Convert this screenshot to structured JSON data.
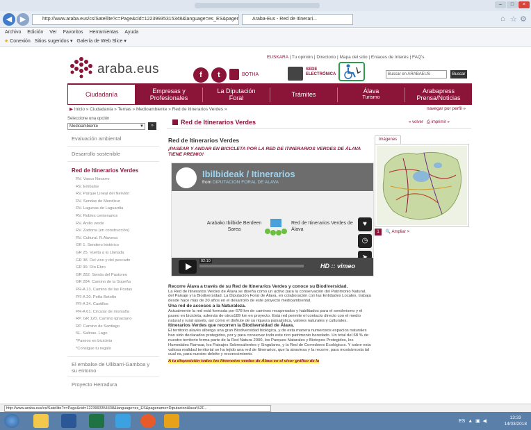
{
  "browser": {
    "address": "http://www.araba.eus/cs/Satellite?c=Page&cid=12239935315348&language=es_ES&pagename=...",
    "tab_title": "Araba-Eus - Red de Itinerari...",
    "menu": [
      "Archivo",
      "Edición",
      "Ver",
      "Favoritos",
      "Herramientas",
      "Ayuda"
    ],
    "favorites": [
      "Conexión",
      "Sitios sugeridos ▾",
      "Galería de Web Slice ▾"
    ],
    "status_url": "http://www.araba.eus/cs/Satellite?c=Page&cid=1223993354438&language=es_ES&pagename=DiputacionAlava%2F..."
  },
  "header": {
    "top_links": [
      "EUSKARA",
      "Tu opinión",
      "Directorio",
      "Mapa del sitio",
      "Enlaces de Interés",
      "FAQ's"
    ],
    "logo_text": "araba.eus",
    "botha_label": "BOTHA",
    "sede_label_1": "SEDE",
    "sede_label_2": "ELECTRÓNICA",
    "search_placeholder": "Buscar en ARABAEUS",
    "search_button": "Buscar"
  },
  "nav": [
    {
      "line1": "Ciudadanía",
      "line2": ""
    },
    {
      "line1": "Empresas y",
      "line2": "Profesionales"
    },
    {
      "line1": "La Diputación",
      "line2": "Foral"
    },
    {
      "line1": "Trámites",
      "line2": ""
    },
    {
      "line1": "Álava",
      "line2": "Turismo"
    },
    {
      "line1": "Arabapress",
      "line2": "Prensa/Noticias"
    }
  ],
  "breadcrumb": [
    "Inicio",
    "Ciudadanía",
    "Temas",
    "Medioambiente",
    "Red de Itinerarios Verdes"
  ],
  "profile_link": "navegar por perfil",
  "selector": {
    "label": "Seleccione una opción",
    "value": "Medioambiente",
    "go": "»"
  },
  "section": {
    "title": "Red de Itinerarios Verdes",
    "back": "« volver",
    "print": "imprimir"
  },
  "sidebar": {
    "top_items": [
      "Evaluación ambiental",
      "Desarrollo sostenible"
    ],
    "heading": "Red de Itinerarios Verdes",
    "sub_items": [
      "RV. Vasco Navarro",
      "RV. Embalse",
      "RV. Parque Lineal del Nervión",
      "RV. Sendas de Mendixur",
      "RV. Lagunas de Laguardia",
      "RV. Robles centenarios",
      "RV. Anillo verde",
      "RV. Zadorra (en construcción)",
      "RV. Cultural. R.Alavesa",
      "GR 1. Sendero histórico",
      "GR 25. Vuelta a la Llanada",
      "GR 38. Del vino y del pescado",
      "GR 99. Río Ebro",
      "GR 282. Senda del Pastoreo",
      "GR 284. Camino de la Sopeña",
      "PR-A 13. Camino de las Postas",
      "PR-A 20. Peña Betoño",
      "PR-A 34. Castillos",
      "PR-A 61. Circular de montaña",
      "RP. GR 120. Camino Ignaciano",
      "RP. Camino de Santiago",
      "SL. Salinas. Lago",
      "*Paseos en bicicleta",
      "*Consigue tu regalo"
    ],
    "bottom_items": [
      "El embalse de Ullibarri-Gamboa y su entorno",
      "Proyecto Herradura"
    ]
  },
  "content": {
    "heading": "Red de Itinerarios Verdes",
    "promo": "¡PASEAR Y ANDAR EN BICICLETA POR LA RED DE ITINERARIOS VERDES DE ÁLAVA TIENE PREMIO!"
  },
  "video": {
    "title": "Ibilbideak / Itinerarios",
    "from_label": "from",
    "from_source": "DIPUTACION FORAL DE ALAVA",
    "left_text": "Arabako Ibilbide Berdeen Sarea",
    "right_text": "Red de Itinerarios Verdes de Álava",
    "time": "02:10",
    "brand": "HD :: vimeo"
  },
  "body": {
    "h1": "Recorre Álava a través de su Red de Itinerarios Verdes y conoce su Biodiversidad.",
    "p1": "La Red de Itinerarios Verdes de Álava se diseña como un activo para la conservación del Patrimonio Natural, del Paisaje y la Biodiversidad. La Diputación Foral de Álava, en colaboración con las Entidades Locales, trabaja desde hace más de 20 años en el desarrollo de este proyecto medioambiental.",
    "h2": "Una red de accesos a la Naturaleza.",
    "p2": "Actualmente la red está formada por 678 km de caminos recuperados y habilitados para el senderismo y el paseo en bicicleta, además de otros189 km en proyecto. Está red permite el contacto directo con el medio natural y rural alavés, así como el disfrute de su riqueza paisajística, valores naturales y culturales.",
    "h3": "Itinerarios Verdes que recorren la Biodiversidad de Álava.",
    "p3": "El territorio alavés alberga una gran Biodiversidad biológica, y de esta manera numerosos espacios naturales han sido declarados protegidos, por y para conservar todo este rico patrimonio heredado. Un total del 68 % de nuestro territorio forma parte de la Red Natura 2000, los Parques Naturales y Biotopos Protegidos, los Humedales Ramsar, los Paisajes Sobresalientes y Singulares, y la Red de Corredores Ecológicos. Y sobre esta valiosa realidad territorial se ha tejido una red de Itinerarios, que la atraviesa y la recorre, para mostrárnosla tal cual es, para nuestro deleite y reconocimiento.",
    "highlight": "A tu disposición todos los Itinerarios verdes de Álava en el visor gráfico de la"
  },
  "map": {
    "tab": "Imágenes",
    "index": "1",
    "enlarge": "Ampliar >"
  },
  "taskbar": {
    "lang": "ES",
    "time": "13:33",
    "date": "14/03/2018"
  },
  "colors": {
    "brand": "#8a1538",
    "access_green": "#2a9d4a",
    "video_title": "#9fd3ef",
    "highlight": "#ffe94d"
  }
}
